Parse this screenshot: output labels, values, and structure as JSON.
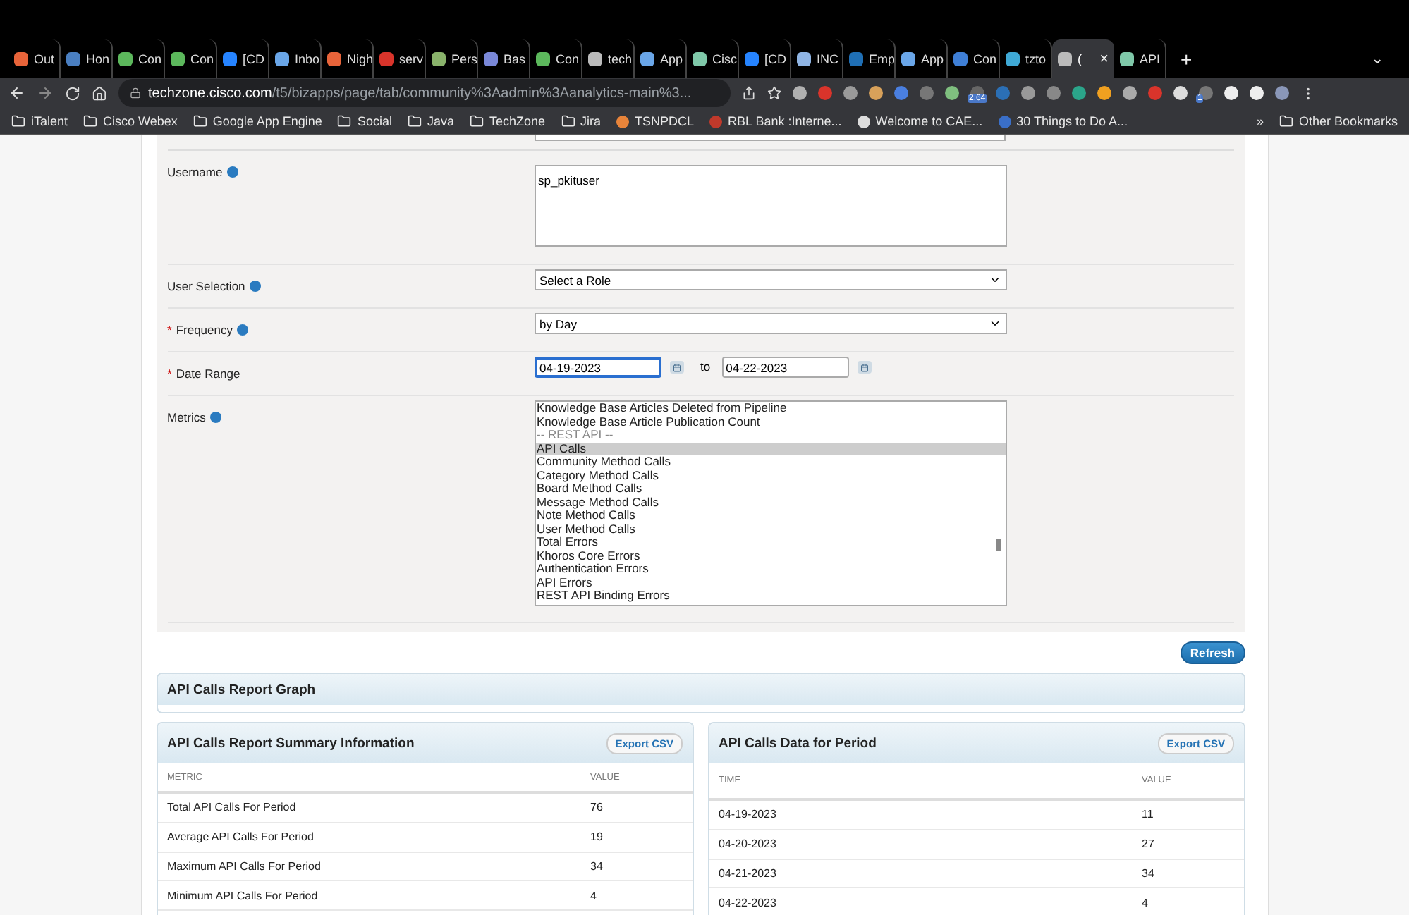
{
  "browser": {
    "tabs": [
      {
        "label": "Out",
        "color": "#e8643a",
        "selected": false
      },
      {
        "label": "Hon",
        "color": "#4a7fc1",
        "selected": false
      },
      {
        "label": "Con",
        "color": "#5cb85c",
        "selected": false
      },
      {
        "label": "Con",
        "color": "#5cb85c",
        "selected": false
      },
      {
        "label": "[CD",
        "color": "#2684ff",
        "selected": false
      },
      {
        "label": "Inbo",
        "color": "#6aa6e8",
        "selected": false
      },
      {
        "label": "Nigh",
        "color": "#e8643a",
        "selected": false
      },
      {
        "label": "serv",
        "color": "#d9342b",
        "selected": false
      },
      {
        "label": "Pers",
        "color": "#8ab36b",
        "selected": false
      },
      {
        "label": "Bas",
        "color": "#7a88d8",
        "selected": false
      },
      {
        "label": "Con",
        "color": "#5cb85c",
        "selected": false
      },
      {
        "label": "tech",
        "color": "#bbbbbb",
        "selected": false
      },
      {
        "label": "App",
        "color": "#6aa6e8",
        "selected": false
      },
      {
        "label": "Cisc",
        "color": "#7fc8a9",
        "selected": false
      },
      {
        "label": "[CD",
        "color": "#2684ff",
        "selected": false
      },
      {
        "label": "INC",
        "color": "#8fb4e3",
        "selected": false
      },
      {
        "label": "Emp",
        "color": "#1f6fb5",
        "selected": false
      },
      {
        "label": "App",
        "color": "#6aa6e8",
        "selected": false
      },
      {
        "label": "Con",
        "color": "#3f7fd6",
        "selected": false
      },
      {
        "label": "tzto",
        "color": "#3fa9d6",
        "selected": false
      },
      {
        "label": "(",
        "color": "#bbbbbb",
        "selected": true,
        "close": "×"
      },
      {
        "label": "API",
        "color": "#7fc8a9",
        "selected": false
      }
    ],
    "new_tab": "+",
    "tab_menu": "⌄",
    "address": {
      "host": "techzone.cisco.com",
      "path": "/t5/bizapps/page/tab/community%3Aadmin%3Aanalytics-main%3..."
    },
    "extensions": [
      {
        "color": "#b0b0b0"
      },
      {
        "color": "#d9342b"
      },
      {
        "color": "#9a9a9a"
      },
      {
        "color": "#d8a15a"
      },
      {
        "color": "#4a7fe0"
      },
      {
        "color": "#777777"
      },
      {
        "color": "#7fbf7f"
      },
      {
        "color": "#666666",
        "badge": "2.64"
      },
      {
        "color": "#2b6fb5"
      },
      {
        "color": "#999999"
      },
      {
        "color": "#888888"
      },
      {
        "color": "#2ba58a"
      },
      {
        "color": "#f0a020"
      },
      {
        "color": "#aaaaaa"
      },
      {
        "color": "#d9342b"
      },
      {
        "color": "#dddddd"
      },
      {
        "color": "#777777",
        "badge": "1"
      },
      {
        "color": "#eeeeee"
      },
      {
        "color": "#eeeeee"
      },
      {
        "color": "#8a97b8"
      }
    ],
    "bookmarks": [
      {
        "label": "iTalent",
        "kind": "folder"
      },
      {
        "label": "Cisco Webex",
        "kind": "folder"
      },
      {
        "label": "Google App Engine",
        "kind": "folder"
      },
      {
        "label": "Social",
        "kind": "folder"
      },
      {
        "label": "Java",
        "kind": "folder"
      },
      {
        "label": "TechZone",
        "kind": "folder"
      },
      {
        "label": "Jira",
        "kind": "folder"
      },
      {
        "label": "TSNPDCL",
        "kind": "site",
        "color": "#e8843a"
      },
      {
        "label": "RBL Bank :Interne...",
        "kind": "site",
        "color": "#c0392b"
      },
      {
        "label": "Welcome to CAE...",
        "kind": "site",
        "color": "#dddddd"
      },
      {
        "label": "30 Things to Do A...",
        "kind": "site",
        "color": "#3a6fc8"
      }
    ],
    "overflow": "»",
    "other_bookmarks": "Other Bookmarks"
  },
  "form": {
    "fields": [
      {
        "kind": "textarea",
        "label": "Username",
        "info": true,
        "value": "sp_pkituser"
      },
      {
        "kind": "select",
        "label": "User Selection",
        "info": true,
        "value": "Select a Role"
      },
      {
        "kind": "select",
        "label": "Frequency",
        "info": true,
        "marker": "*",
        "value": "by Day"
      },
      {
        "kind": "date_range",
        "label": "Date Range",
        "info": false,
        "marker": "*",
        "from": "04-19-2023",
        "from_focused": true,
        "separator": "to",
        "to": "04-22-2023"
      },
      {
        "kind": "listbox",
        "label": "Metrics",
        "info": true,
        "options": [
          {
            "label": "Knowledge Base Articles Deleted from Pipeline",
            "kind": "option",
            "selected": false
          },
          {
            "label": "Knowledge Base Article Publication Count",
            "kind": "option",
            "selected": false
          },
          {
            "label": "-- REST API --",
            "kind": "group",
            "selected": false
          },
          {
            "label": "API Calls",
            "kind": "option",
            "selected": true
          },
          {
            "label": "Community Method Calls",
            "kind": "option",
            "selected": false
          },
          {
            "label": "Category Method Calls",
            "kind": "option",
            "selected": false
          },
          {
            "label": "Board Method Calls",
            "kind": "option",
            "selected": false
          },
          {
            "label": "Message Method Calls",
            "kind": "option",
            "selected": false
          },
          {
            "label": "Note Method Calls",
            "kind": "option",
            "selected": false
          },
          {
            "label": "User Method Calls",
            "kind": "option",
            "selected": false
          },
          {
            "label": "Total Errors",
            "kind": "option",
            "selected": false
          },
          {
            "label": "Khoros Core Errors",
            "kind": "option",
            "selected": false
          },
          {
            "label": "Authentication Errors",
            "kind": "option",
            "selected": false
          },
          {
            "label": "API Errors",
            "kind": "option",
            "selected": false
          },
          {
            "label": "REST API Binding Errors",
            "kind": "option",
            "selected": false
          }
        ]
      }
    ]
  },
  "refresh_button": "Refresh",
  "graph_panel": {
    "title": "API Calls Report Graph"
  },
  "summary": {
    "title": "API Calls Report Summary Information",
    "export": "Export CSV",
    "columns": [
      "METRIC",
      "VALUE"
    ],
    "rows": [
      [
        "Total API Calls For Period",
        "76"
      ],
      [
        "Average API Calls For Period",
        "19"
      ],
      [
        "Maximum API Calls For Period",
        "34"
      ],
      [
        "Minimum API Calls For Period",
        "4"
      ]
    ]
  },
  "period_data": {
    "title": "API Calls Data for Period",
    "export": "Export CSV",
    "columns": [
      "TIME",
      "VALUE"
    ],
    "rows": [
      [
        "04-19-2023",
        "11"
      ],
      [
        "04-20-2023",
        "27"
      ],
      [
        "04-21-2023",
        "34"
      ],
      [
        "04-22-2023",
        "4"
      ]
    ]
  }
}
